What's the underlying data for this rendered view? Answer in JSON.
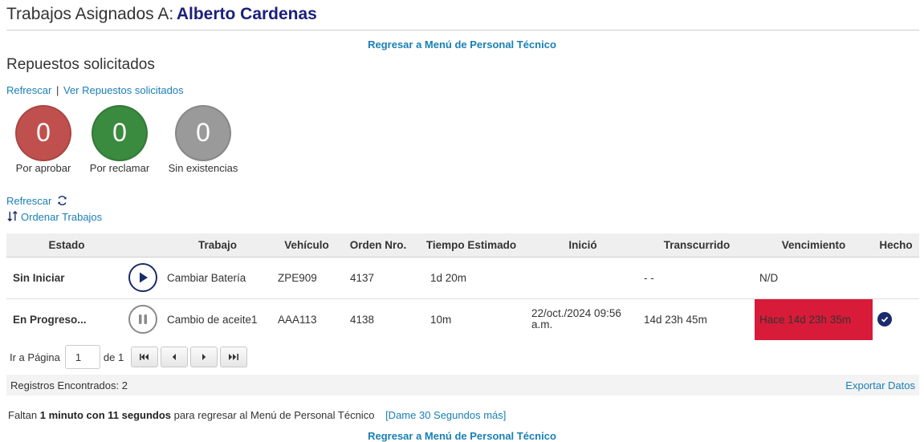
{
  "header": {
    "prefix": "Trabajos Asignados A:",
    "name": "Alberto Cardenas"
  },
  "back_link": "Regresar a Menú de Personal Técnico",
  "parts": {
    "title": "Repuestos solicitados",
    "refresh": "Refrescar",
    "separator": "|",
    "view": "Ver Repuestos solicitados",
    "counters": [
      {
        "value": "0",
        "label": "Por aprobar",
        "color": "#c0504d"
      },
      {
        "value": "0",
        "label": "Por reclamar",
        "color": "#3a8a3f"
      },
      {
        "value": "0",
        "label": "Sin existencias",
        "color": "#9a9a9a"
      }
    ]
  },
  "jobs_refresh": "Refrescar",
  "order_jobs": "Ordenar Trabajos",
  "table": {
    "headers": [
      "Estado",
      "",
      "Trabajo",
      "Vehículo",
      "Orden Nro.",
      "Tiempo Estimado",
      "Inició",
      "Transcurrido",
      "Vencimiento",
      "Hecho"
    ],
    "rows": [
      {
        "status": "Sin Iniciar",
        "action": "play-icon",
        "job": "Cambiar Batería",
        "vehicle": "ZPE909",
        "order": "4137",
        "estimate": "1d 20m",
        "started": "",
        "elapsed": "- -",
        "due": "N/D",
        "done": false
      },
      {
        "status": "En Progreso...",
        "action": "pause-icon",
        "job": "Cambio de aceite1",
        "vehicle": "AAA113",
        "order": "4138",
        "estimate": "10m",
        "started": "22/oct./2024 09:56 a.m.",
        "elapsed": "14d 23h 45m",
        "due": "Hace 14d 23h 35m",
        "done": true
      }
    ]
  },
  "pager": {
    "goto_label": "Ir a Página",
    "page": "1",
    "of_label": "de 1"
  },
  "footer": {
    "records": "Registros Encontrados: 2",
    "export": "Exportar Datos"
  },
  "timer": {
    "prefix": "Faltan",
    "time": "1 minuto con 11 segundos",
    "suffix": "para regresar al Menú de Personal Técnico",
    "more": "[Dame 30 Segundos más]"
  },
  "colors": {
    "link": "#1a7fb5",
    "brand_dark": "#1b1f7a",
    "status_not_started": "#c0142a",
    "status_in_progress": "#2e8b2e",
    "overdue": "#d81b38"
  }
}
